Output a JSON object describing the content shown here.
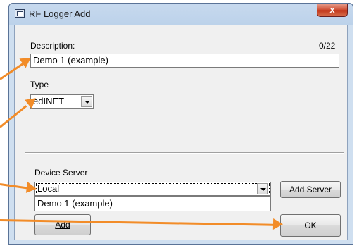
{
  "window": {
    "title": "RF Logger Add",
    "close_label": "x"
  },
  "description": {
    "label": "Description:",
    "counter": "0/22",
    "value": "Demo 1 (example)"
  },
  "type": {
    "label": "Type",
    "selected": "edINET"
  },
  "device_server": {
    "label": "Device Server",
    "selected": "Local",
    "options_visible": [
      "Demo 1 (example)"
    ],
    "add_server_label": "Add Server"
  },
  "buttons": {
    "add_label": "Add",
    "ok_label": "OK"
  },
  "annotation": {
    "arrow_color": "#f28c28"
  }
}
